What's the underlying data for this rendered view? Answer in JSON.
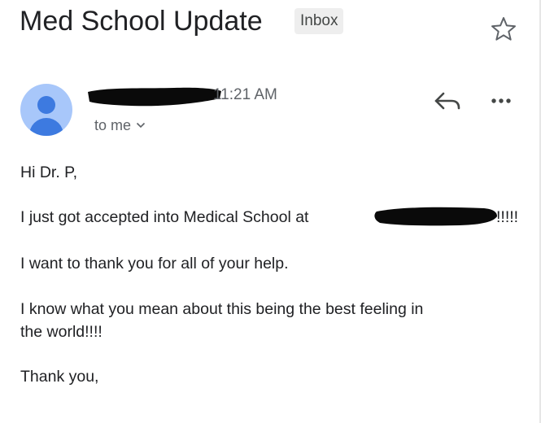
{
  "email": {
    "subject": "Med School Update",
    "label_badge": "Inbox",
    "sender_time": "11:21 AM",
    "recipient": "to me",
    "body": {
      "greeting": "Hi Dr. P,",
      "line1_before": "I just got accepted into Medical School at",
      "line1_after": "!!!!!",
      "line2": "I want to thank you for all of your help.",
      "line3a": "I know what you mean about this being the best feeling in",
      "line3b": "the world!!!!",
      "closing": "Thank you,"
    }
  },
  "icons": {
    "star": "star-outline-icon",
    "reply": "reply-icon",
    "more": "more-horizontal-icon",
    "avatar": "default-avatar-icon",
    "chevron": "chevron-down-icon"
  },
  "colors": {
    "avatar_bg": "#a8c7fa",
    "avatar_fg": "#3d7ae0",
    "badge_bg": "#eeeeee",
    "secondary_text": "#5f6368"
  }
}
